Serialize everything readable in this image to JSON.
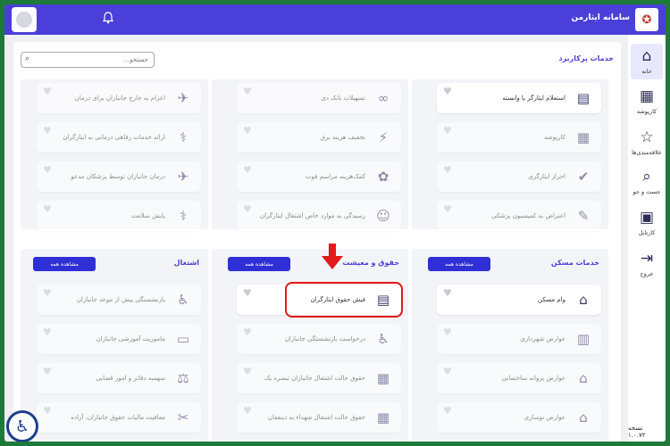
{
  "app": {
    "title": "سامانه ایثارمن",
    "logo_icon": "emblem-icon",
    "version": "نسخه ۱.۰.۷۲"
  },
  "header": {
    "notification_icon": "bell-icon",
    "avatar_icon": "user-avatar"
  },
  "sidebar": {
    "items": [
      {
        "label": "خانه",
        "icon": "home-icon",
        "glyph": "⌂",
        "active": true
      },
      {
        "label": "کارپوشه",
        "icon": "folder-user-icon",
        "glyph": "▦"
      },
      {
        "label": "علاقه‌مندی‌ها",
        "icon": "star-icon",
        "glyph": "☆"
      },
      {
        "label": "جست و جو",
        "icon": "search-icon",
        "glyph": "⌕"
      },
      {
        "label": "کارتابل",
        "icon": "briefcase-icon",
        "glyph": "▣"
      },
      {
        "label": "خروج",
        "icon": "logout-icon",
        "glyph": "⇥"
      }
    ]
  },
  "top_section": {
    "title": "خدمات پرکاربرد",
    "search_placeholder": "جستجو...",
    "col_right": [
      {
        "text": "استعلام ایثارگر یا وابسته",
        "icon": "id-card-icon",
        "glyph": "▤",
        "ghost": false
      },
      {
        "text": "کارپوشه",
        "icon": "folder-user-icon",
        "glyph": "▦",
        "ghost": true
      },
      {
        "text": "احراز ایثارگری",
        "icon": "verify-icon",
        "glyph": "✔",
        "ghost": true
      },
      {
        "text": "اعتراض به کمیسیون پزشکی",
        "icon": "document-edit-icon",
        "glyph": "✎",
        "ghost": true
      }
    ],
    "col_mid": [
      {
        "text": "تسهیلات بانک دی",
        "icon": "bank-loan-icon",
        "glyph": "∞",
        "ghost": true
      },
      {
        "text": "تخفیف هزینه برق",
        "icon": "electricity-icon",
        "glyph": "⚡",
        "ghost": true
      },
      {
        "text": "کمک‌هزینه مراسم فوت",
        "icon": "funeral-icon",
        "glyph": "✿",
        "ghost": true
      },
      {
        "text": "رسیدگی به موارد خاص اشتغال ایثارگران",
        "icon": "support-icon",
        "glyph": "☺",
        "ghost": true
      }
    ],
    "col_left": [
      {
        "text": "اعزام به خارج جانبازان برای درمان",
        "icon": "plane-medical-icon",
        "glyph": "✈",
        "ghost": true
      },
      {
        "text": "ارائه خدمات رفاهی درمانی به ایثارگران",
        "icon": "medical-report-icon",
        "glyph": "⚕",
        "ghost": true
      },
      {
        "text": "درمان جانبازان توسط پزشکان مدعو",
        "icon": "plane-doctor-icon",
        "glyph": "✈",
        "ghost": true
      },
      {
        "text": "پایش سلامت",
        "icon": "health-check-icon",
        "glyph": "⚕",
        "ghost": true
      }
    ]
  },
  "panels": {
    "housing": {
      "title": "خدمات مسکن",
      "view_all": "مشاهده همه",
      "items": [
        {
          "text": "وام مسکن",
          "icon": "house-loan-icon",
          "glyph": "⌂",
          "ghost": false
        },
        {
          "text": "عوارض شهرداری",
          "icon": "municipality-icon",
          "glyph": "▥",
          "ghost": true
        },
        {
          "text": "عوارض پروانه ساختمانی",
          "icon": "building-permit-icon",
          "glyph": "⌂",
          "ghost": true
        },
        {
          "text": "عوارض نوسازی",
          "icon": "renovation-icon",
          "glyph": "⌂",
          "ghost": true
        }
      ]
    },
    "salary": {
      "title": "حقوق و معیشت",
      "view_all": "مشاهده همه",
      "items": [
        {
          "text": "فیش حقوق ایثارگران",
          "icon": "payslip-icon",
          "glyph": "▤",
          "ghost": false
        },
        {
          "text": "درخواست بازنشستگی جانبازان",
          "icon": "rocking-chair-icon",
          "glyph": "♿",
          "ghost": true
        },
        {
          "text": "حقوق حالت اشتغال جانبازان تبصره یک",
          "icon": "calendar-icon",
          "glyph": "▦",
          "ghost": true
        },
        {
          "text": "حقوق حالت اشتغال شهداء به ذینفعان",
          "icon": "calendar-icon",
          "glyph": "▦",
          "ghost": true
        }
      ]
    },
    "employment": {
      "title": "اشتغال",
      "view_all": "مشاهده همه",
      "items": [
        {
          "text": "بازنشستگی پیش از موعد جانبازان",
          "icon": "rocking-chair-icon",
          "glyph": "♿",
          "ghost": true
        },
        {
          "text": "ماموریت آموزشی جانبازان",
          "icon": "teaching-icon",
          "glyph": "▭",
          "ghost": true
        },
        {
          "text": "سهمیه دفاتر و امور قضایی",
          "icon": "scales-icon",
          "glyph": "⚖",
          "ghost": true
        },
        {
          "text": "معافیت مالیات حقوق جانبازان، آزاده",
          "icon": "tax-icon",
          "glyph": "✂",
          "ghost": true
        }
      ]
    }
  },
  "annotation": {
    "highlight_color": "#e21a1a",
    "arrow_icon": "down-arrow-icon"
  }
}
